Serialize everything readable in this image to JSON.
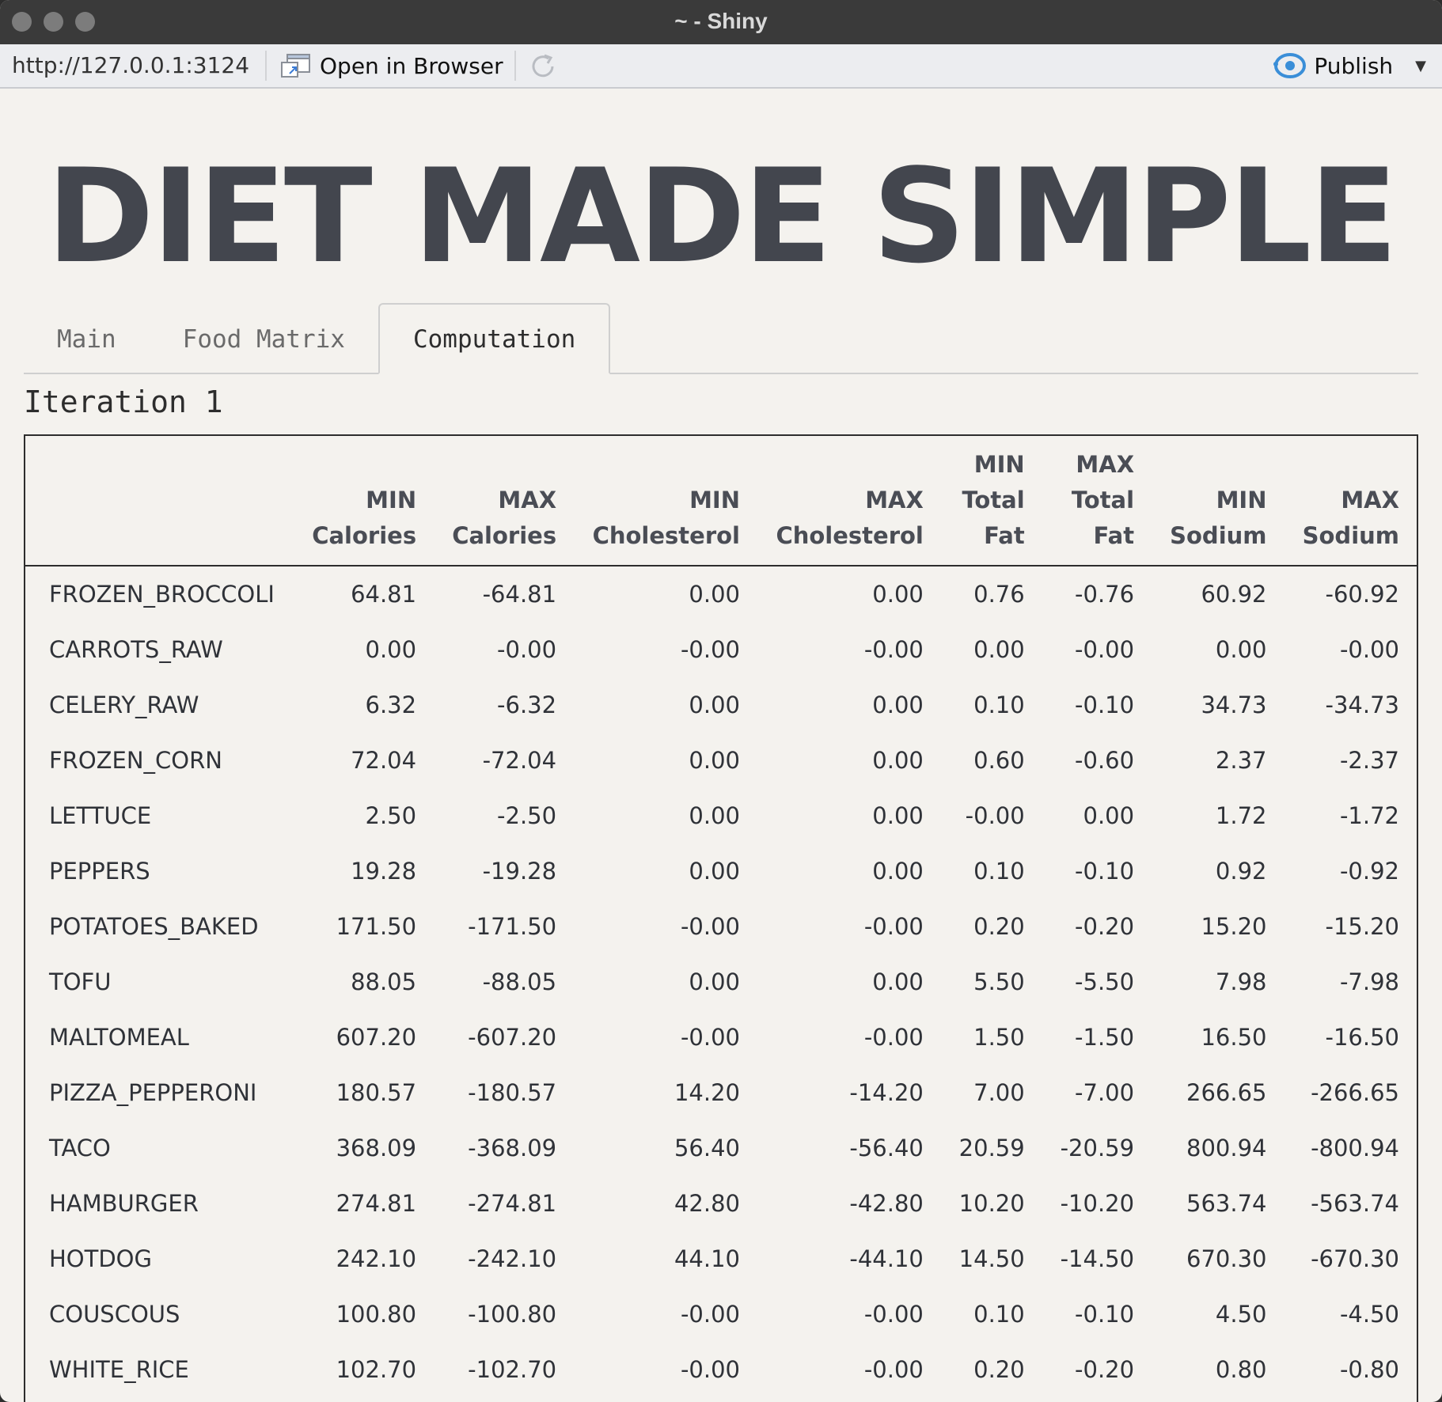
{
  "window": {
    "title": "~ - Shiny"
  },
  "toolbar": {
    "url": "http://127.0.0.1:3124",
    "open_in_browser": "Open in Browser",
    "publish": "Publish",
    "accent": "#3a8ed8"
  },
  "app": {
    "title": "DIET MADE SIMPLE",
    "tabs": [
      {
        "label": "Main",
        "active": false
      },
      {
        "label": "Food Matrix",
        "active": false
      },
      {
        "label": "Computation",
        "active": true
      }
    ],
    "iteration_label": "Iteration 1"
  },
  "table": {
    "headers": [
      [
        "",
        ""
      ],
      [
        "MIN",
        "Calories"
      ],
      [
        "MAX",
        "Calories"
      ],
      [
        "MIN",
        "Cholesterol"
      ],
      [
        "MAX",
        "Cholesterol"
      ],
      [
        "MIN",
        "Total",
        "Fat"
      ],
      [
        "MAX",
        "Total",
        "Fat"
      ],
      [
        "MIN",
        "Sodium"
      ],
      [
        "MAX",
        "Sodium"
      ]
    ],
    "rows": [
      [
        "FROZEN_BROCCOLI",
        "64.81",
        "-64.81",
        "0.00",
        "0.00",
        "0.76",
        "-0.76",
        "60.92",
        "-60.92"
      ],
      [
        "CARROTS_RAW",
        "0.00",
        "-0.00",
        "-0.00",
        "-0.00",
        "0.00",
        "-0.00",
        "0.00",
        "-0.00"
      ],
      [
        "CELERY_RAW",
        "6.32",
        "-6.32",
        "0.00",
        "0.00",
        "0.10",
        "-0.10",
        "34.73",
        "-34.73"
      ],
      [
        "FROZEN_CORN",
        "72.04",
        "-72.04",
        "0.00",
        "0.00",
        "0.60",
        "-0.60",
        "2.37",
        "-2.37"
      ],
      [
        "LETTUCE",
        "2.50",
        "-2.50",
        "0.00",
        "0.00",
        "-0.00",
        "0.00",
        "1.72",
        "-1.72"
      ],
      [
        "PEPPERS",
        "19.28",
        "-19.28",
        "0.00",
        "0.00",
        "0.10",
        "-0.10",
        "0.92",
        "-0.92"
      ],
      [
        "POTATOES_BAKED",
        "171.50",
        "-171.50",
        "-0.00",
        "-0.00",
        "0.20",
        "-0.20",
        "15.20",
        "-15.20"
      ],
      [
        "TOFU",
        "88.05",
        "-88.05",
        "0.00",
        "0.00",
        "5.50",
        "-5.50",
        "7.98",
        "-7.98"
      ],
      [
        "MALTOMEAL",
        "607.20",
        "-607.20",
        "-0.00",
        "-0.00",
        "1.50",
        "-1.50",
        "16.50",
        "-16.50"
      ],
      [
        "PIZZA_PEPPERONI",
        "180.57",
        "-180.57",
        "14.20",
        "-14.20",
        "7.00",
        "-7.00",
        "266.65",
        "-266.65"
      ],
      [
        "TACO",
        "368.09",
        "-368.09",
        "56.40",
        "-56.40",
        "20.59",
        "-20.59",
        "800.94",
        "-800.94"
      ],
      [
        "HAMBURGER",
        "274.81",
        "-274.81",
        "42.80",
        "-42.80",
        "10.20",
        "-10.20",
        "563.74",
        "-563.74"
      ],
      [
        "HOTDOG",
        "242.10",
        "-242.10",
        "44.10",
        "-44.10",
        "14.50",
        "-14.50",
        "670.30",
        "-670.30"
      ],
      [
        "COUSCOUS",
        "100.80",
        "-100.80",
        "-0.00",
        "-0.00",
        "0.10",
        "-0.10",
        "4.50",
        "-4.50"
      ],
      [
        "WHITE_RICE",
        "102.70",
        "-102.70",
        "-0.00",
        "-0.00",
        "0.20",
        "-0.20",
        "0.80",
        "-0.80"
      ]
    ]
  }
}
